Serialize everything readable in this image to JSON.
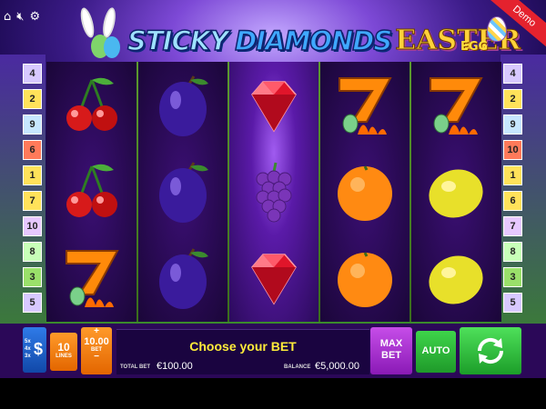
{
  "header": {
    "icons": [
      "home-icon",
      "speaker-muted-icon",
      "settings-gear-icon"
    ],
    "logo_word1": "STICKY",
    "logo_word2": "DIAMONDS",
    "logo_word3": "EASTER",
    "logo_word4": "EGG",
    "demo_ribbon": "Demo"
  },
  "paylines": {
    "left": [
      {
        "label": "4",
        "color": "#d8c9ff"
      },
      {
        "label": "2",
        "color": "#ffe25a"
      },
      {
        "label": "9",
        "color": "#c7e7ff"
      },
      {
        "label": "6",
        "color": "#ff7a5a"
      },
      {
        "label": "1",
        "color": "#ffe25a"
      },
      {
        "label": "7",
        "color": "#ffe25a"
      },
      {
        "label": "10",
        "color": "#e7c8ff"
      },
      {
        "label": "8",
        "color": "#c8ffb8"
      },
      {
        "label": "3",
        "color": "#9ae06a"
      },
      {
        "label": "5",
        "color": "#d8c9ff"
      }
    ],
    "right": [
      {
        "label": "4",
        "color": "#d8c9ff"
      },
      {
        "label": "2",
        "color": "#ffe25a"
      },
      {
        "label": "9",
        "color": "#c7e7ff"
      },
      {
        "label": "10",
        "color": "#ff7a5a"
      },
      {
        "label": "1",
        "color": "#ffe25a"
      },
      {
        "label": "6",
        "color": "#ffe25a"
      },
      {
        "label": "7",
        "color": "#e7c8ff"
      },
      {
        "label": "8",
        "color": "#c8ffb8"
      },
      {
        "label": "3",
        "color": "#9ae06a"
      },
      {
        "label": "5",
        "color": "#d8c9ff"
      }
    ]
  },
  "reels": [
    {
      "glow": false,
      "symbols": [
        "cherry",
        "cherry",
        "seven"
      ]
    },
    {
      "glow": false,
      "symbols": [
        "plum",
        "plum",
        "plum"
      ]
    },
    {
      "glow": true,
      "symbols": [
        "diamond",
        "grapes",
        "diamond"
      ]
    },
    {
      "glow": false,
      "symbols": [
        "seven",
        "orange",
        "orange"
      ]
    },
    {
      "glow": false,
      "symbols": [
        "seven",
        "lemon",
        "lemon"
      ]
    }
  ],
  "controls": {
    "coin_labels": [
      "5x",
      "4x",
      "3x"
    ],
    "coin_symbol": "$",
    "lines_value": "10",
    "lines_label": "LINES",
    "bet_plus": "+",
    "bet_value": "10.00",
    "bet_label": "BET",
    "bet_minus": "−",
    "message": "Choose your BET",
    "total_bet_label": "TOTAL BET",
    "total_bet_value": "€100.00",
    "balance_label": "BALANCE",
    "balance_value": "€5,000.00",
    "max_bet_line1": "MAX",
    "max_bet_line2": "BET",
    "auto_label": "AUTO"
  }
}
